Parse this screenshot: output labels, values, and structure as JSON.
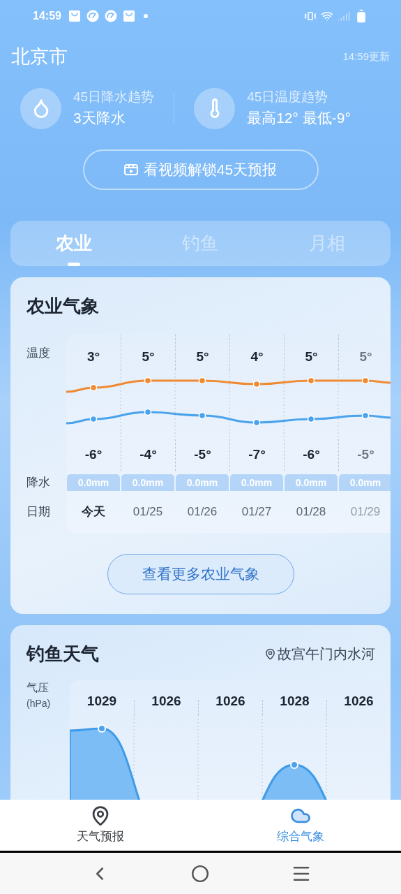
{
  "status_bar": {
    "time": "14:59"
  },
  "header": {
    "city": "北京市",
    "updated": "14:59更新"
  },
  "trends": [
    {
      "kind": "rain",
      "title": "45日降水趋势",
      "value": "3天降水"
    },
    {
      "kind": "temperature",
      "title": "45日温度趋势",
      "value": "最高12° 最低-9°"
    }
  ],
  "unlock_button": "看视频解锁45天预报",
  "tabs": [
    {
      "label": "农业",
      "selected": true
    },
    {
      "label": "钓鱼",
      "selected": false
    },
    {
      "label": "月相",
      "selected": false
    }
  ],
  "agriculture": {
    "title": "农业气象",
    "row_labels": [
      "温度",
      "降水",
      "日期"
    ],
    "days": [
      {
        "high": "3°",
        "low": "-6°",
        "precip": "0.0mm",
        "date": "今天",
        "today": true
      },
      {
        "high": "5°",
        "low": "-4°",
        "precip": "0.0mm",
        "date": "01/25",
        "today": false
      },
      {
        "high": "5°",
        "low": "-5°",
        "precip": "0.0mm",
        "date": "01/26",
        "today": false
      },
      {
        "high": "4°",
        "low": "-7°",
        "precip": "0.0mm",
        "date": "01/27",
        "today": false
      },
      {
        "high": "5°",
        "low": "-6°",
        "precip": "0.0mm",
        "date": "01/28",
        "today": false
      },
      {
        "high": "5°",
        "low": "-5°",
        "precip": "0.0mm",
        "date": "01/29",
        "today": false
      }
    ],
    "more_button": "查看更多农业气象"
  },
  "fishing": {
    "title": "钓鱼天气",
    "location": "故宫午门内水河",
    "axis_label": "气压",
    "unit": "(hPa)",
    "pressures": [
      "1029",
      "1026",
      "1026",
      "1028",
      "1026"
    ]
  },
  "bottom_nav": [
    {
      "kind": "forecast",
      "label": "天气预报",
      "selected": false
    },
    {
      "kind": "weather",
      "label": "综合气象",
      "selected": true
    }
  ]
}
